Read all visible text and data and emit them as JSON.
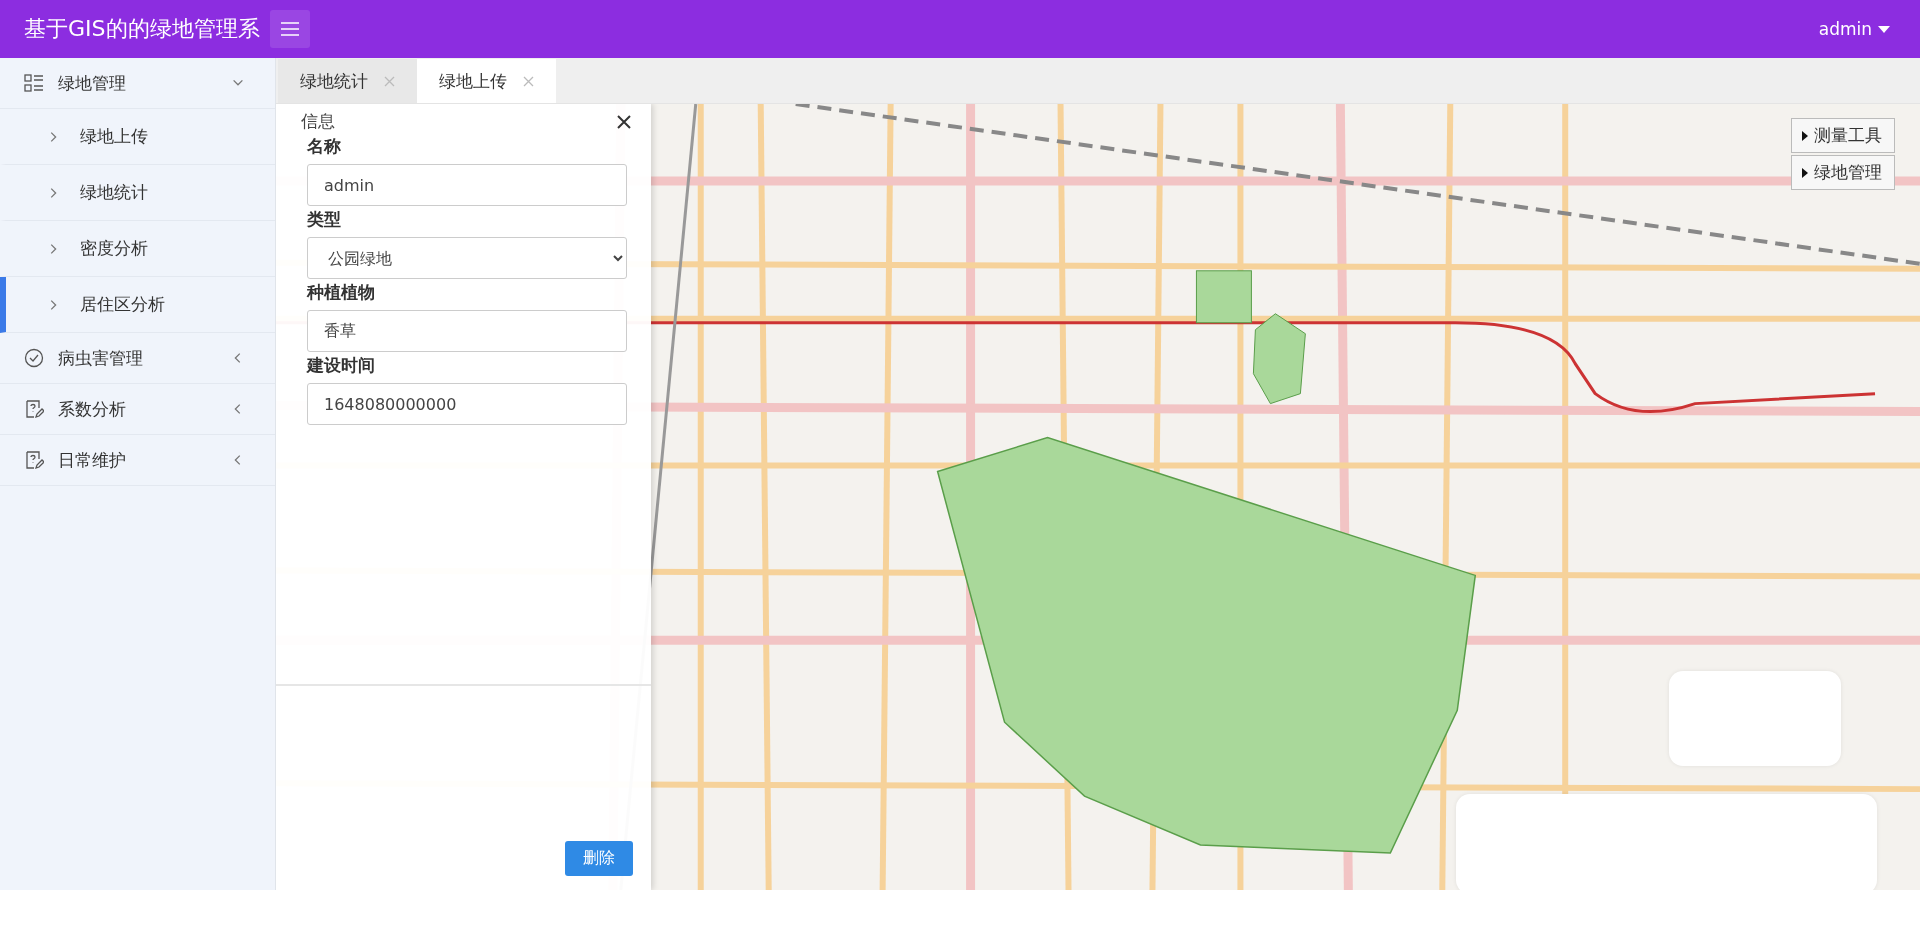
{
  "header": {
    "title": "基于GIS的的绿地管理系",
    "user": "admin"
  },
  "sidebar": {
    "items": [
      {
        "kind": "list",
        "label": "绿地管理",
        "expanded": true,
        "children": [
          {
            "label": "绿地上传",
            "selected": false
          },
          {
            "label": "绿地统计",
            "selected": false
          },
          {
            "label": "密度分析",
            "selected": false
          },
          {
            "label": "居住区分析",
            "selected": true
          }
        ]
      },
      {
        "kind": "check",
        "label": "病虫害管理",
        "expanded": false
      },
      {
        "kind": "note",
        "label": "系数分析",
        "expanded": false
      },
      {
        "kind": "note",
        "label": "日常维护",
        "expanded": false
      }
    ]
  },
  "tabs": [
    {
      "label": "绿地统计",
      "selected": false
    },
    {
      "label": "绿地上传",
      "selected": true
    }
  ],
  "panel": {
    "title": "信息",
    "fields": [
      {
        "kind": "input",
        "label": "名称",
        "value": "admin"
      },
      {
        "kind": "select",
        "label": "类型",
        "value": "公园绿地"
      },
      {
        "kind": "input",
        "label": "种植植物",
        "value": "香草"
      },
      {
        "kind": "input",
        "label": "建设时间",
        "value": "1648080000000"
      }
    ],
    "delete_button": "删除"
  },
  "map_controls": [
    "测量工具",
    "绿地管理"
  ]
}
